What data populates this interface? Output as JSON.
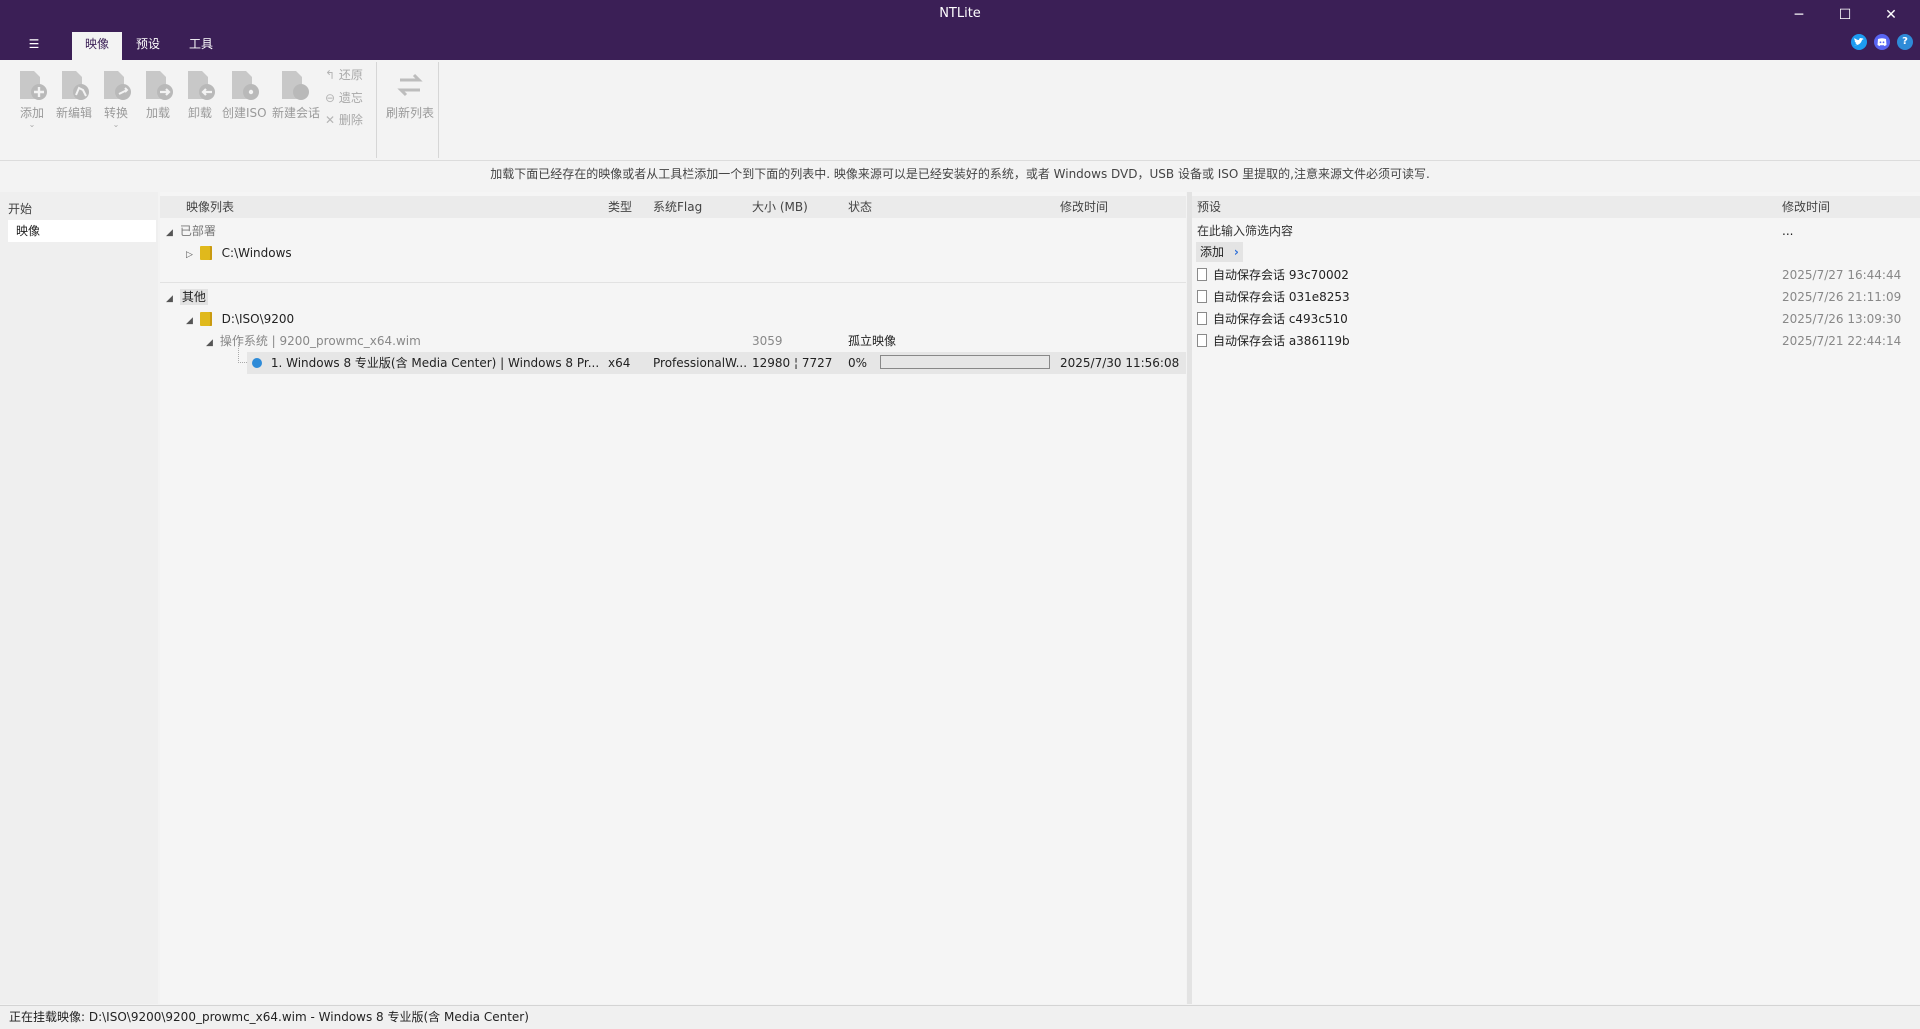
{
  "window": {
    "title": "NTLite",
    "menu_icon": "☰",
    "minimize": "─",
    "maximize": "☐",
    "close": "✕"
  },
  "tabs": [
    "映像",
    "预设",
    "工具"
  ],
  "social_icons": [
    "twitter-icon",
    "discord-icon",
    "help-icon"
  ],
  "ribbon": {
    "buttons": [
      {
        "label": "添加",
        "icon": "add-icon",
        "has_dropdown": true
      },
      {
        "label": "新编辑",
        "icon": "new-edit-icon",
        "has_dropdown": false
      },
      {
        "label": "转换",
        "icon": "convert-icon",
        "has_dropdown": true
      },
      {
        "label": "加载",
        "icon": "load-icon",
        "has_dropdown": false
      },
      {
        "label": "卸载",
        "icon": "unload-icon",
        "has_dropdown": false
      },
      {
        "label": "创建ISO",
        "icon": "create-iso-icon",
        "has_dropdown": false
      },
      {
        "label": "新建会话",
        "icon": "new-session-icon",
        "has_dropdown": false
      }
    ],
    "small_buttons": [
      {
        "label": "还原",
        "icon": "restore-icon"
      },
      {
        "label": "遗忘",
        "icon": "forget-icon"
      },
      {
        "label": "删除",
        "icon": "delete-icon"
      }
    ],
    "refresh": {
      "label": "刷新列表",
      "icon": "refresh-icon"
    }
  },
  "info_text": "加载下面已经存在的映像或者从工具栏添加一个到下面的列表中. 映像来源可以是已经安装好的系统，或者 Windows DVD，USB 设备或 ISO 里提取的,注意来源文件必须可读写.",
  "left_nav": {
    "header": "开始",
    "items": [
      "映像"
    ]
  },
  "image_list": {
    "columns": [
      "映像列表",
      "类型",
      "系统Flag",
      "大小 (MB)",
      "状态",
      "修改时间"
    ],
    "groups": [
      {
        "name": "已部署",
        "items": [
          {
            "path": "C:\\Windows"
          }
        ]
      },
      {
        "name": "其他",
        "items": [
          {
            "path": "D:\\ISO\\9200",
            "children": [
              {
                "label": "操作系统  |  9200_prowmc_x64.wim",
                "size": "3059",
                "status": "孤立映像",
                "editions": [
                  {
                    "name": "1. Windows 8 专业版(含 Media Center)  |  Windows 8 Pr...",
                    "type": "x64",
                    "flag": "ProfessionalW...",
                    "size": "12980 ¦ 7727",
                    "status": "0%",
                    "progress": 0,
                    "modified": "2025/7/30 11:56:08"
                  }
                ]
              }
            ]
          }
        ]
      }
    ]
  },
  "presets": {
    "columns": [
      "预设",
      "修改时间"
    ],
    "filter_placeholder": "在此输入筛选内容",
    "filter_extra": "...",
    "add_label": "添加",
    "items": [
      {
        "name": "自动保存会话 93c70002",
        "time": "2025/7/27 16:44:44"
      },
      {
        "name": "自动保存会话 031e8253",
        "time": "2025/7/26 21:11:09"
      },
      {
        "name": "自动保存会话 c493c510",
        "time": "2025/7/26 13:09:30"
      },
      {
        "name": "自动保存会话 a386119b",
        "time": "2025/7/21 22:44:14"
      }
    ]
  },
  "status_bar": "正在挂载映像: D:\\ISO\\9200\\9200_prowmc_x64.wim - Windows 8 专业版(含 Media Center)",
  "colors": {
    "titlebar": "#3b1f56",
    "accent": "#2e8bd8",
    "folder": "#e0b91c"
  }
}
